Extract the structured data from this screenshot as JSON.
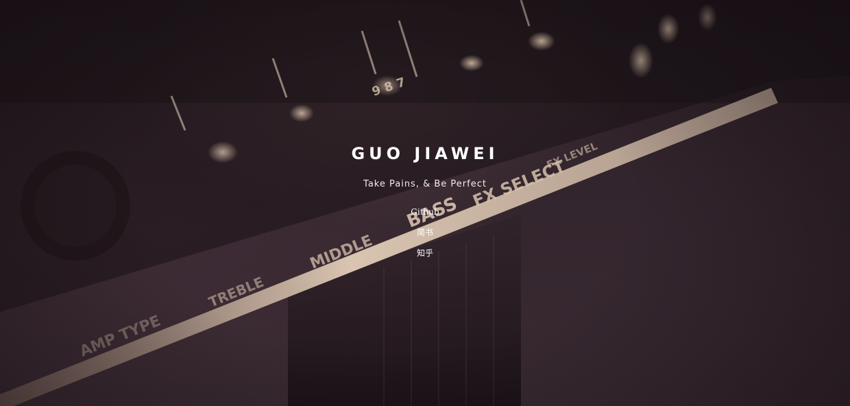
{
  "hero": {
    "title": "GUO JIAWEI",
    "subtitle": "Take Pains, & Be Perfect",
    "background_image": "guitar-amplifier-photo"
  },
  "amp_labels": {
    "bass": "BASS",
    "middle": "MIDDLE",
    "treble": "TREBLE",
    "amp_type": "AMP TYPE",
    "fx_select": "FX SELECT",
    "fx_level": "FX LEVEL",
    "knob_digits": "9 8 7"
  },
  "links": [
    {
      "label": "Github"
    },
    {
      "label": "简书"
    },
    {
      "label": "知乎"
    }
  ],
  "colors": {
    "background": "#2d2127",
    "panel_strip": "#d9c3b0",
    "text": "#ffffff"
  }
}
